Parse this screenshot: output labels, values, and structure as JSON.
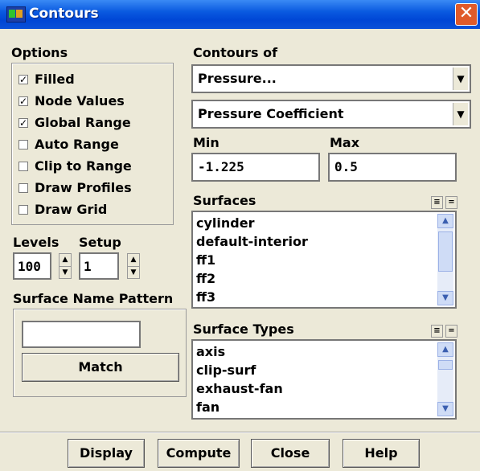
{
  "window": {
    "title": "Contours",
    "close_glyph": "✕"
  },
  "options": {
    "label": "Options",
    "checkboxes": [
      {
        "label": "Filled",
        "checked": true
      },
      {
        "label": "Node Values",
        "checked": true
      },
      {
        "label": "Global Range",
        "checked": true
      },
      {
        "label": "Auto Range",
        "checked": false
      },
      {
        "label": "Clip to Range",
        "checked": false
      },
      {
        "label": "Draw Profiles",
        "checked": false
      },
      {
        "label": "Draw Grid",
        "checked": false
      }
    ]
  },
  "levels": {
    "label": "Levels",
    "value": "100"
  },
  "setup": {
    "label": "Setup",
    "value": "1"
  },
  "surface_name_pattern": {
    "label": "Surface Name Pattern",
    "value": "",
    "match_label": "Match"
  },
  "contours_of": {
    "label": "Contours of",
    "category": "Pressure...",
    "quantity": "Pressure Coefficient"
  },
  "range": {
    "min_label": "Min",
    "min_value": "-1.225",
    "max_label": "Max",
    "max_value": "0.5"
  },
  "surfaces": {
    "label": "Surfaces",
    "items": [
      "cylinder",
      "default-interior",
      "ff1",
      "ff2",
      "ff3"
    ]
  },
  "surface_types": {
    "label": "Surface Types",
    "items": [
      "axis",
      "clip-surf",
      "exhaust-fan",
      "fan"
    ]
  },
  "buttons": {
    "display": "Display",
    "compute": "Compute",
    "close": "Close",
    "help": "Help"
  },
  "icons": {
    "title": "fluent-app-icon",
    "close": "close-icon",
    "combo": "chevron-down-icon",
    "select_all": "select-all-icon",
    "deselect_all": "deselect-all-icon"
  }
}
